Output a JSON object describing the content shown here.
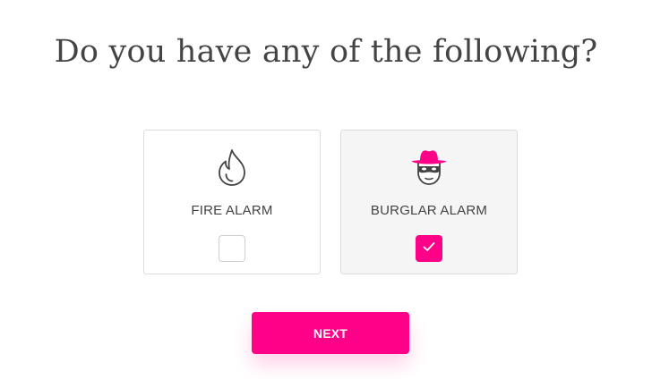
{
  "question": {
    "title": "Do you have any of the following?"
  },
  "options": [
    {
      "label": "FIRE ALARM",
      "icon": "flame-icon",
      "checked": false
    },
    {
      "label": "BURGLAR ALARM",
      "icon": "burglar-icon",
      "checked": true
    }
  ],
  "next_button": {
    "label": "NEXT"
  },
  "colors": {
    "accent": "#ff0088",
    "text": "#444444",
    "border": "#dcdcdc",
    "selected_background": "#f5f5f5"
  }
}
